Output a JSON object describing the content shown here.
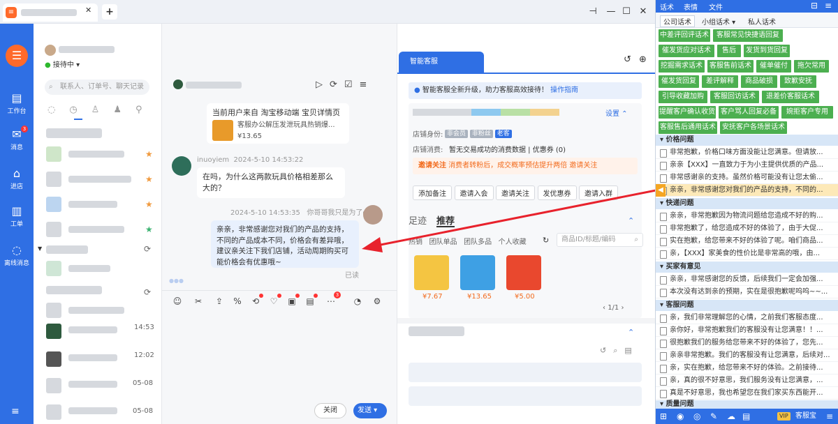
{
  "window": {
    "tab_close": "✕",
    "tab_add": "+"
  },
  "nav": {
    "items": [
      {
        "label": "工作台",
        "icon": "dashboard-icon"
      },
      {
        "label": "消息",
        "icon": "message-icon",
        "badge": "3"
      },
      {
        "label": "进店",
        "icon": "store-icon"
      },
      {
        "label": "工单",
        "icon": "ticket-icon"
      },
      {
        "label": "离线消息",
        "icon": "offline-message-icon"
      }
    ]
  },
  "contacts": {
    "status": "接待中",
    "search_placeholder": "联系人、订单号、聊天记录",
    "expand": "展开",
    "times": [
      "14:53",
      "12:02",
      "05-08",
      "05-08"
    ]
  },
  "chat": {
    "card_title": "当前用户来自 淘宝移动端 宝贝详情页",
    "card_product": "客服办公解压发泄玩具热销爆...",
    "card_price": "¥13.65",
    "cust_name": "inuoyiem",
    "cust_time": "2024-5-10 14:53:22",
    "cust_msg": "在吗，为什么这两款玩具价格相差那么大的？",
    "agent_time": "2024-5-10 14:53:35",
    "agent_name": "你哥哥我只是为了qb",
    "agent_msg": "亲亲，非常感谢您对我们的产品的支持，不同的产品成本不同，价格会有差异哦，建议亲关注下我们店铺，活动周期购买可能价格会有优惠哦~",
    "read": "已读",
    "close_btn": "关闭",
    "send_btn": "发送",
    "toolbar_badge": "3"
  },
  "smart": {
    "tab": "智能客服",
    "notice": "智能客服全新升级，助力客服高效接待！",
    "notice_link": "操作指南",
    "settings": "设置",
    "identity_label": "店铺身份:",
    "tags": [
      "非会员",
      "非粉丝",
      "老客"
    ],
    "consume_label": "店铺消费:",
    "consume_text": "暂无交易成功的消费数据 | 优惠券 (0)",
    "invite_title": "邀请关注",
    "invite_text": "消费者转粉后，成交概率预估提升两倍",
    "invite_btn": "邀请关注",
    "actions": [
      "添加备注",
      "邀请入会",
      "邀请关注",
      "发优惠券",
      "邀请入群"
    ],
    "footprint_tab": "足迹",
    "recommend_tab": "推荐",
    "sub_tabs": [
      "热销",
      "团队单品",
      "团队多品",
      "个人收藏"
    ],
    "product_search_placeholder": "商品ID/标题/编码",
    "products": [
      {
        "price": "¥7.67"
      },
      {
        "price": "¥13.65"
      },
      {
        "price": "¥5.00"
      }
    ],
    "pager": "1/1"
  },
  "scripts": {
    "top_tabs": [
      "话术",
      "表情",
      "文件"
    ],
    "sub_tabs": [
      "公司话术",
      "小组话术",
      "私人话术"
    ],
    "buttons": [
      "中差评回评话术",
      "客服常见快捷语回复",
      "催发货应对话术",
      "售后",
      "发货到货回复",
      "挖掘需求话术",
      "客服售前话术",
      "催单催付",
      "拖欠常用",
      "催发货回复",
      "差评解释",
      "商品破损",
      "致歉安抚",
      "引导收藏加购",
      "客服回访话术",
      "退差价客服话术",
      "提醒客户确认收货",
      "客户骂人回复必备",
      "婉拒客户专用",
      "客服售后通用话术",
      "安抚客户各场景话术"
    ],
    "categories": [
      {
        "title": "价格问题",
        "items": [
          "非常抱歉，价格口味方面没能让您满意。但请放...",
          "亲亲【XXX】一直致力于为小主提供优质的产品...",
          "非常感谢亲的支持。虽然价格可能没有让您太偷...",
          "亲亲，非常感谢您对我们的产品的支持，不同的..."
        ]
      },
      {
        "title": "快递问题",
        "items": [
          "亲亲，非常抱歉因为物流问题给您造成不好的购...",
          "非常抱歉了，给您造成不好的体验了，由于大促...",
          "实在抱歉，给您带来不好的体验了呢。咱们商品...",
          "亲，【XXX】家美食的性价比是非常高的哦，由..."
        ]
      },
      {
        "title": "买家有意见",
        "items": [
          "亲亲，非常感谢您的反馈，后续我们一定会加强...",
          "本次没有达到亲的预期，实在是很抱歉呢呜呜~~..."
        ]
      },
      {
        "title": "客服问题",
        "items": [
          "亲，我们非常理解您的心情，之前我们客服态度...",
          "亲你好，非常抱歉我们的客服没有让您满意！！...",
          "很抱歉我们的服务给您带来不好的体验了，您先...",
          "亲亲非常抱歉。我们的客服没有让您满意，后续对...",
          "亲，实在抱歉，给您带来不好的体验。之前接待...",
          "亲，真的很不好意思，我们服务没有让您满意，...",
          "真是不好意思，我也希望您在我们家买东西能开..."
        ]
      },
      {
        "title": "质量问题",
        "items": []
      }
    ],
    "footer_vip": "VIP",
    "footer_label": "客服宝"
  }
}
